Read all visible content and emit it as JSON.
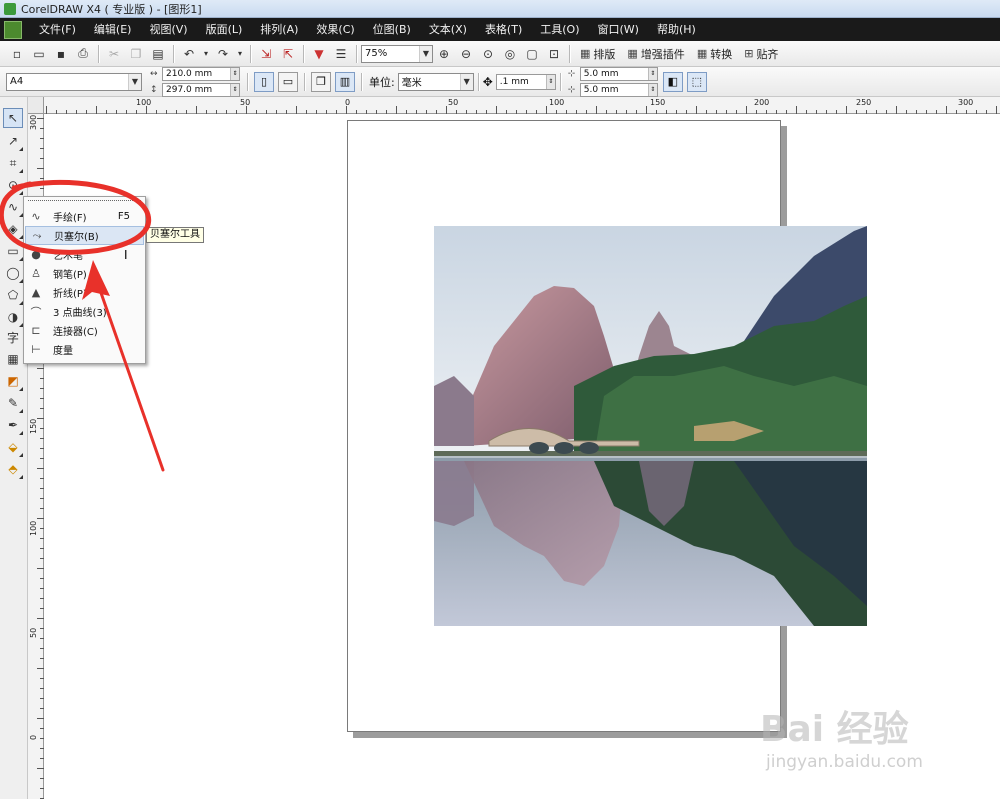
{
  "window": {
    "title": "CorelDRAW X4 ( 专业版 ) - [图形1]"
  },
  "menu": [
    "文件(F)",
    "编辑(E)",
    "视图(V)",
    "版面(L)",
    "排列(A)",
    "效果(C)",
    "位图(B)",
    "文本(X)",
    "表格(T)",
    "工具(O)",
    "窗口(W)",
    "帮助(H)"
  ],
  "toolbar": {
    "zoom": "75%",
    "layout_label": "排版",
    "plugins_label": "增强插件",
    "convert_label": "转换",
    "snap_label": "贴齐"
  },
  "propertybar": {
    "paper": "A4",
    "width": "210.0 mm",
    "height": "297.0 mm",
    "unit_label": "单位:",
    "unit": "毫米",
    "nudge": ".1 mm",
    "dup_x": "5.0 mm",
    "dup_y": "5.0 mm"
  },
  "ruler": {
    "h_labels": [
      "100",
      "50",
      "0",
      "50",
      "100",
      "150",
      "200",
      "250",
      "300"
    ],
    "v_labels": [
      "300",
      "150",
      "100",
      "50",
      "0"
    ]
  },
  "flyout": {
    "items": [
      {
        "icon": "freehand-icon",
        "label": "手绘(F)",
        "key": "F5"
      },
      {
        "icon": "bezier-icon",
        "label": "贝塞尔(B)",
        "key": ""
      },
      {
        "icon": "artistic-media-icon",
        "label": "艺术笔",
        "key": ""
      },
      {
        "icon": "pen-icon",
        "label": "钢笔(P)",
        "key": ""
      },
      {
        "icon": "polyline-icon",
        "label": "折线(P)",
        "key": ""
      },
      {
        "icon": "three-point-curve-icon",
        "label": "3 点曲线(3)",
        "key": ""
      },
      {
        "icon": "connector-icon",
        "label": "连接器(C)",
        "key": ""
      },
      {
        "icon": "dimension-icon",
        "label": "度量",
        "key": ""
      }
    ],
    "highlighted_index": 1
  },
  "tooltip": "贝塞尔工具",
  "annotation": {
    "color": "#e8312a"
  },
  "watermark": {
    "main": "Bai 经验",
    "url": "jingyan.baidu.com"
  }
}
